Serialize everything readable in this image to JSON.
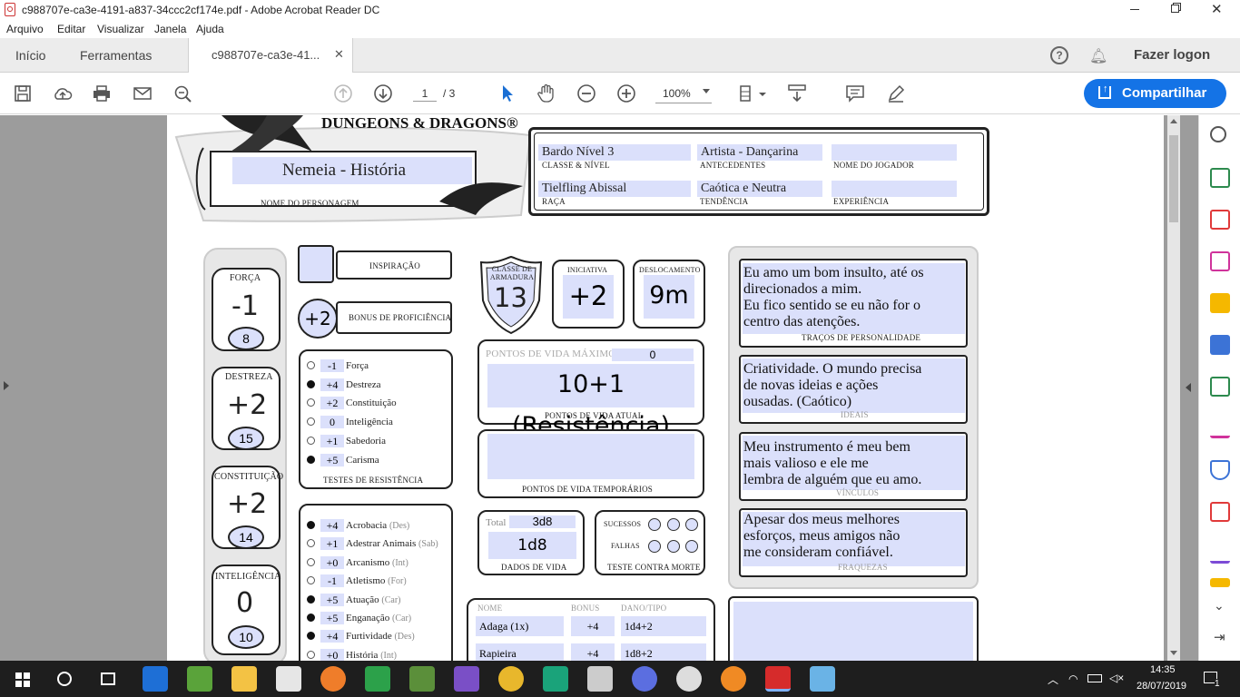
{
  "window": {
    "title": "c988707e-ca3e-4191-a837-34ccc2cf174e.pdf - Adobe Acrobat Reader DC"
  },
  "menu": [
    "Arquivo",
    "Editar",
    "Visualizar",
    "Janela",
    "Ajuda"
  ],
  "tabs": {
    "home": "Início",
    "tools": "Ferramentas",
    "doc": "c988707e-ca3e-41..."
  },
  "account": {
    "login": "Fazer logon"
  },
  "toolbar": {
    "page_current": "1",
    "page_total": "/ 3",
    "zoom": "100%",
    "share": "Compartilhar"
  },
  "sheet": {
    "logo": "DUNGEONS & DRAGONS®",
    "character_name": "Nemeia - História",
    "character_name_label": "NOME DO PERSONAGEM",
    "class_level": "Bardo Nível 3",
    "class_level_label": "CLASSE & NÍVEL",
    "background": "Artista - Dançarina",
    "background_label": "ANTECEDENTES",
    "player_label": "NOME DO JOGADOR",
    "race": "Tielfling Abissal",
    "race_label": "RAÇA",
    "alignment": "Caótica e Neutra",
    "alignment_label": "TENDÊNCIA",
    "xp_label": "EXPERIÊNCIA",
    "abilities": [
      {
        "name": "FORÇA",
        "mod": "-1",
        "score": "8"
      },
      {
        "name": "DESTREZA",
        "mod": "+2",
        "score": "15"
      },
      {
        "name": "CONSTITUIÇÃO",
        "mod": "+2",
        "score": "14"
      },
      {
        "name": "INTELIGÊNCIA",
        "mod": "0",
        "score": "10"
      }
    ],
    "inspiration_label": "INSPIRAÇÃO",
    "proficiency": "+2",
    "proficiency_label": "BONUS DE PROFICIÊNCIA",
    "saves_label": "TESTES DE RESISTÊNCIA",
    "saves": [
      {
        "val": "-1",
        "name": "Força",
        "prof": false
      },
      {
        "val": "+4",
        "name": "Destreza",
        "prof": true
      },
      {
        "val": "+2",
        "name": "Constituição",
        "prof": false
      },
      {
        "val": "0",
        "name": "Inteligência",
        "prof": false
      },
      {
        "val": "+1",
        "name": "Sabedoria",
        "prof": false
      },
      {
        "val": "+5",
        "name": "Carisma",
        "prof": true
      }
    ],
    "skills": [
      {
        "val": "+4",
        "name": "Acrobacia",
        "attr": "(Des)",
        "prof": true
      },
      {
        "val": "+1",
        "name": "Adestrar Animais",
        "attr": "(Sab)",
        "prof": false
      },
      {
        "val": "+0",
        "name": "Arcanismo",
        "attr": "(Int)",
        "prof": false
      },
      {
        "val": "-1",
        "name": "Atletismo",
        "attr": "(For)",
        "prof": false
      },
      {
        "val": "+5",
        "name": "Atuação",
        "attr": "(Car)",
        "prof": true
      },
      {
        "val": "+5",
        "name": "Enganação",
        "attr": "(Car)",
        "prof": true
      },
      {
        "val": "+4",
        "name": "Furtividade",
        "attr": "(Des)",
        "prof": true
      },
      {
        "val": "+0",
        "name": "História",
        "attr": "(Int)",
        "prof": false
      }
    ],
    "ac": "13",
    "ac_label": "CLASSE DE ARMADURA",
    "initiative": "+2",
    "initiative_label": "INICIATIVA",
    "speed": "9m",
    "speed_label": "DESLOCAMENTO",
    "hp_max_label": "PONTOS DE VIDA MÁXIMO",
    "hp_max": "0",
    "hp_current": "10+1 (Resistência)",
    "hp_current_label": "PONTOS DE VIDA ATUAL",
    "hp_temp_label": "PONTOS DE VIDA TEMPORÁRIOS",
    "hit_dice_total_label": "Total",
    "hit_dice_total": "3d8",
    "hit_dice": "1d8",
    "hit_dice_label": "DADOS DE VIDA",
    "death_success": "SUCESSOS",
    "death_fail": "FALHAS",
    "death_label": "TESTE CONTRA MORTE",
    "attacks_headers": [
      "NOME",
      "BONUS",
      "DANO/TIPO"
    ],
    "attacks": [
      {
        "name": "Adaga (1x)",
        "bonus": "+4",
        "damage": "1d4+2"
      },
      {
        "name": "Rapieira",
        "bonus": "+4",
        "damage": "1d8+2"
      }
    ],
    "traits": "Eu amo um bom insulto, até os\ndirecionados a mim.\nEu fico sentido se eu não for o\ncentro das atenções.",
    "traits_label": "TRAÇOS DE PERSONALIDADE",
    "ideals": "Criatividade. O mundo precisa\nde novas ideias e ações\nousadas. (Caótico)",
    "ideals_label": "IDEAIS",
    "bonds": "Meu instrumento é meu bem\nmais valioso e ele me\nlembra de alguém que eu amo.",
    "bonds_label": "VÍNCULOS",
    "flaws": "Apesar dos meus melhores\nesforços, meus amigos não\nme consideram confiável.",
    "flaws_label": "FRAQUEZAS"
  },
  "taskbar": {
    "time": "14:35",
    "date": "28/07/2019",
    "notif": "1"
  }
}
